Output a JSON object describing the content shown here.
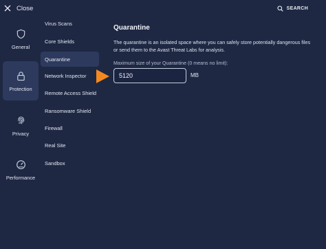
{
  "topbar": {
    "close_label": "Close",
    "search_label": "SEARCH"
  },
  "categories": [
    {
      "label": "General",
      "icon": "shield-icon"
    },
    {
      "label": "Protection",
      "icon": "lock-icon",
      "active": true
    },
    {
      "label": "Privacy",
      "icon": "fingerprint-icon"
    },
    {
      "label": "Performance",
      "icon": "gauge-icon"
    }
  ],
  "subnav": [
    {
      "label": "Virus Scans"
    },
    {
      "label": "Core Shields"
    },
    {
      "label": "Quarantine",
      "active": true
    },
    {
      "label": "Network Inspector"
    },
    {
      "label": "Remote Access Shield"
    },
    {
      "label": "Ransomware Shield"
    },
    {
      "label": "Firewall"
    },
    {
      "label": "Real Site"
    },
    {
      "label": "Sandbox"
    }
  ],
  "content": {
    "title": "Quarantine",
    "description": "The quarantine is an isolated space where you can safely store potentially dangerous files or send them to the Avast Threat Labs for analysis.",
    "size_label": "Maximum size of your Quarantine (0 means no limit):",
    "size_value": "5120",
    "size_unit": "MB"
  },
  "colors": {
    "background": "#1e2843",
    "active_item": "#2d3a5d",
    "annotation_arrow": "#f5891f"
  }
}
